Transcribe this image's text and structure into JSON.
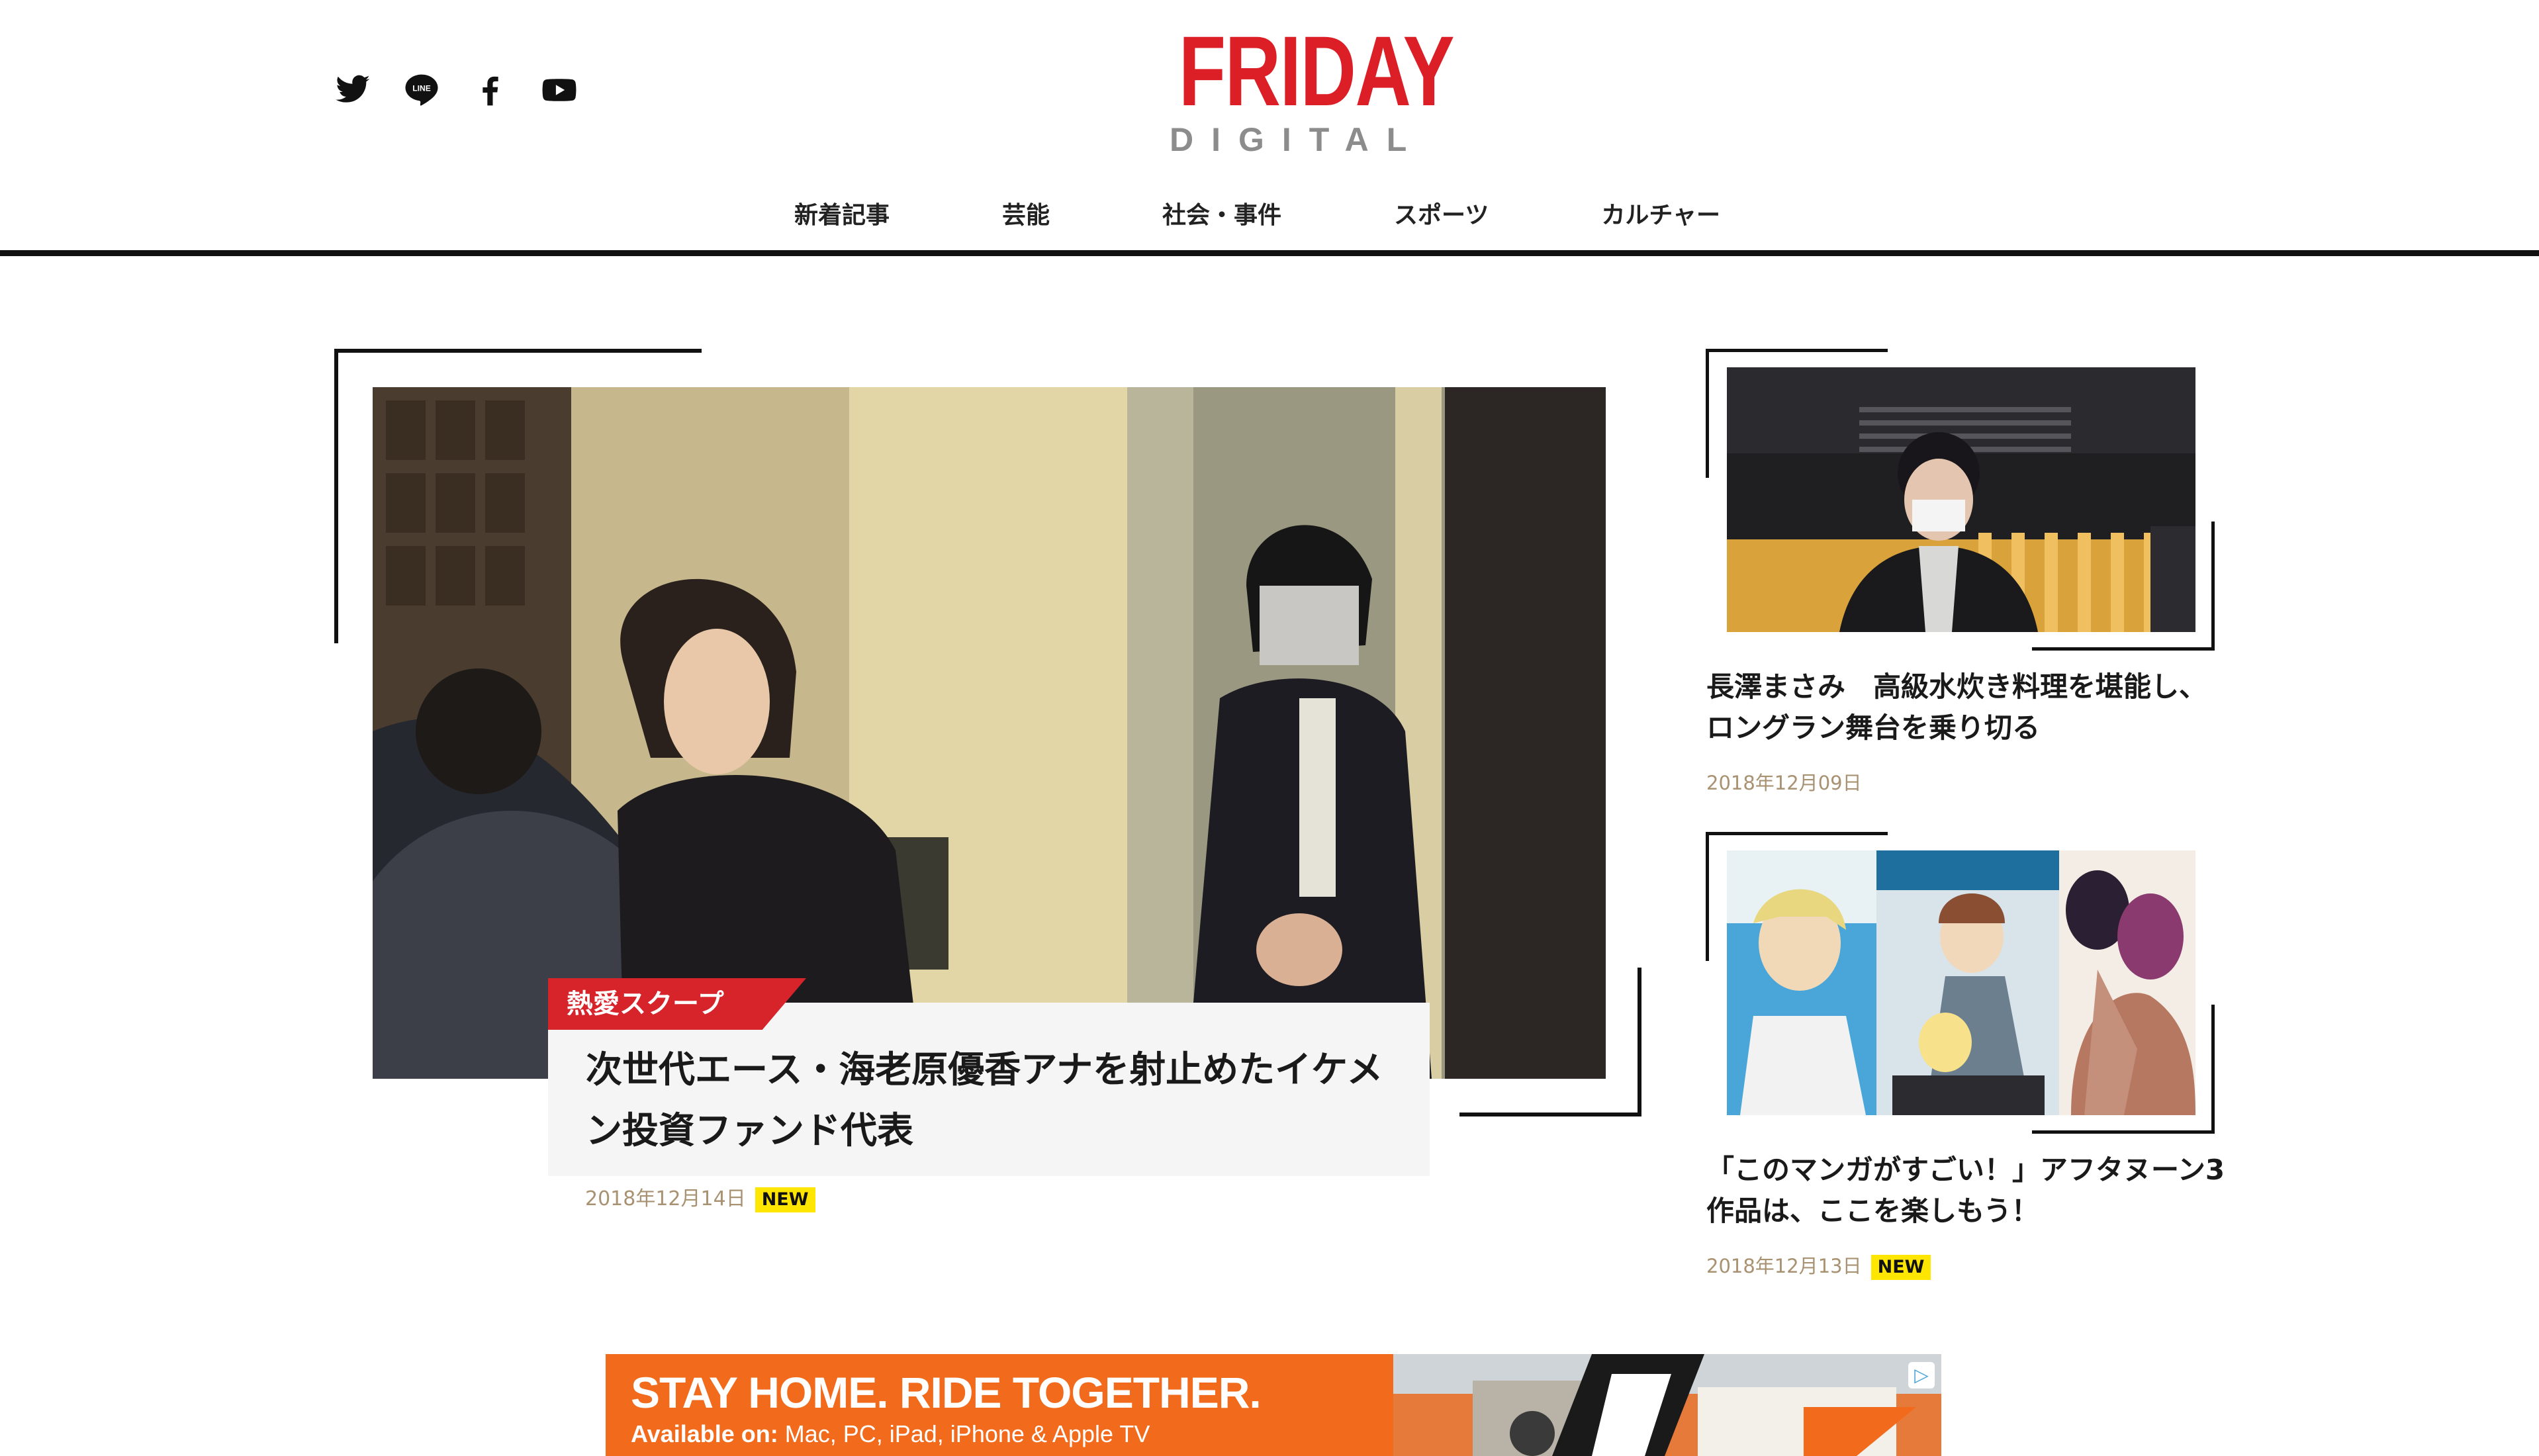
{
  "header": {
    "social": [
      {
        "name": "twitter-icon"
      },
      {
        "name": "line-icon",
        "label": "LINE"
      },
      {
        "name": "facebook-icon"
      },
      {
        "name": "youtube-icon"
      }
    ],
    "logo_main": "FRIDAY",
    "logo_sub": "DIGITAL"
  },
  "nav": {
    "items": [
      "新着記事",
      "芸能",
      "社会・事件",
      "スポーツ",
      "カルチャー"
    ]
  },
  "featured": {
    "tag": "熱愛スクープ",
    "title": "次世代エース・海老原優香アナを射止めたイケメン投資ファンド代表",
    "date": "2018年12月14日",
    "badge": "NEW"
  },
  "side_articles": [
    {
      "title": "長澤まさみ　高級水炊き料理を堪能し、ロングラン舞台を乗り切る",
      "date": "2018年12月09日",
      "badge": ""
    },
    {
      "title": "「このマンガがすごい！」アフタヌーン3作品は、ここを楽しもう！",
      "date": "2018年12月13日",
      "badge": "NEW"
    }
  ],
  "ad": {
    "headline": "STAY HOME. RIDE TOGETHER.",
    "sub_label": "Available on:",
    "sub_text": " Mac, PC, iPad, iPhone & Apple TV",
    "choices_icon": "adchoices-icon",
    "brand_color": "#f26a1b"
  },
  "colors": {
    "brand_red": "#dc1f26",
    "logo_gray": "#8c8c8c",
    "date_color": "#a89272",
    "badge_yellow": "#ffe600"
  }
}
